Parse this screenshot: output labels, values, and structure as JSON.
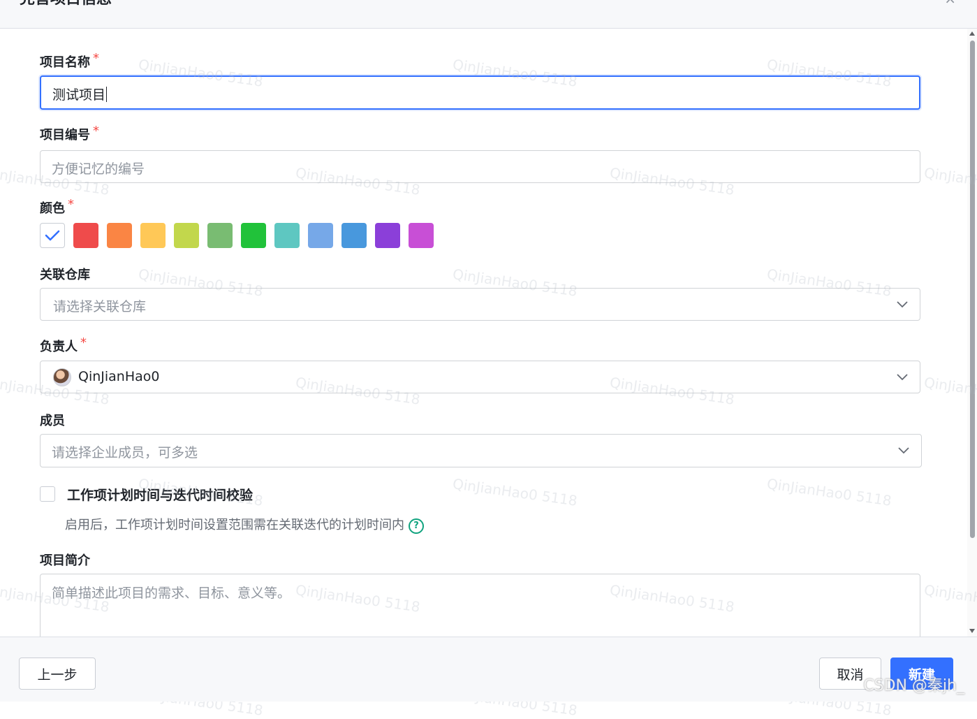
{
  "dialog": {
    "title": "完善项目信息",
    "close_label": "×"
  },
  "form": {
    "name": {
      "label": "项目名称",
      "required_mark": "*",
      "value": "测试项目"
    },
    "code": {
      "label": "项目编号",
      "required_mark": "*",
      "placeholder": "方便记忆的编号"
    },
    "color": {
      "label": "颜色",
      "required_mark": "*",
      "selected_index": 0,
      "swatches": [
        "#ffffff",
        "#ef4b4b",
        "#fa8544",
        "#ffc857",
        "#c2d74c",
        "#79bc72",
        "#21c23a",
        "#5ec7c1",
        "#76a8e8",
        "#4898dd",
        "#8b3fd9",
        "#c84fd6"
      ]
    },
    "repo": {
      "label": "关联仓库",
      "placeholder": "请选择关联仓库"
    },
    "owner": {
      "label": "负责人",
      "required_mark": "*",
      "value": "QinJianHao0"
    },
    "members": {
      "label": "成员",
      "placeholder": "请选择企业成员，可多选"
    },
    "validation": {
      "checked": false,
      "label": "工作项计划时间与迭代时间校验",
      "hint": "启用后，工作项计划时间设置范围需在关联迭代的计划时间内",
      "help_icon": "?"
    },
    "description": {
      "label": "项目简介",
      "placeholder": "简单描述此项目的需求、目标、意义等。"
    }
  },
  "footer": {
    "prev_label": "上一步",
    "cancel_label": "取消",
    "create_label": "新建"
  },
  "watermark_text": "QinJianHao0 5118",
  "credit": "CSDN @秦jh_",
  "colors": {
    "primary": "#3370ff",
    "required": "#f54a45",
    "help": "#10a37f"
  }
}
